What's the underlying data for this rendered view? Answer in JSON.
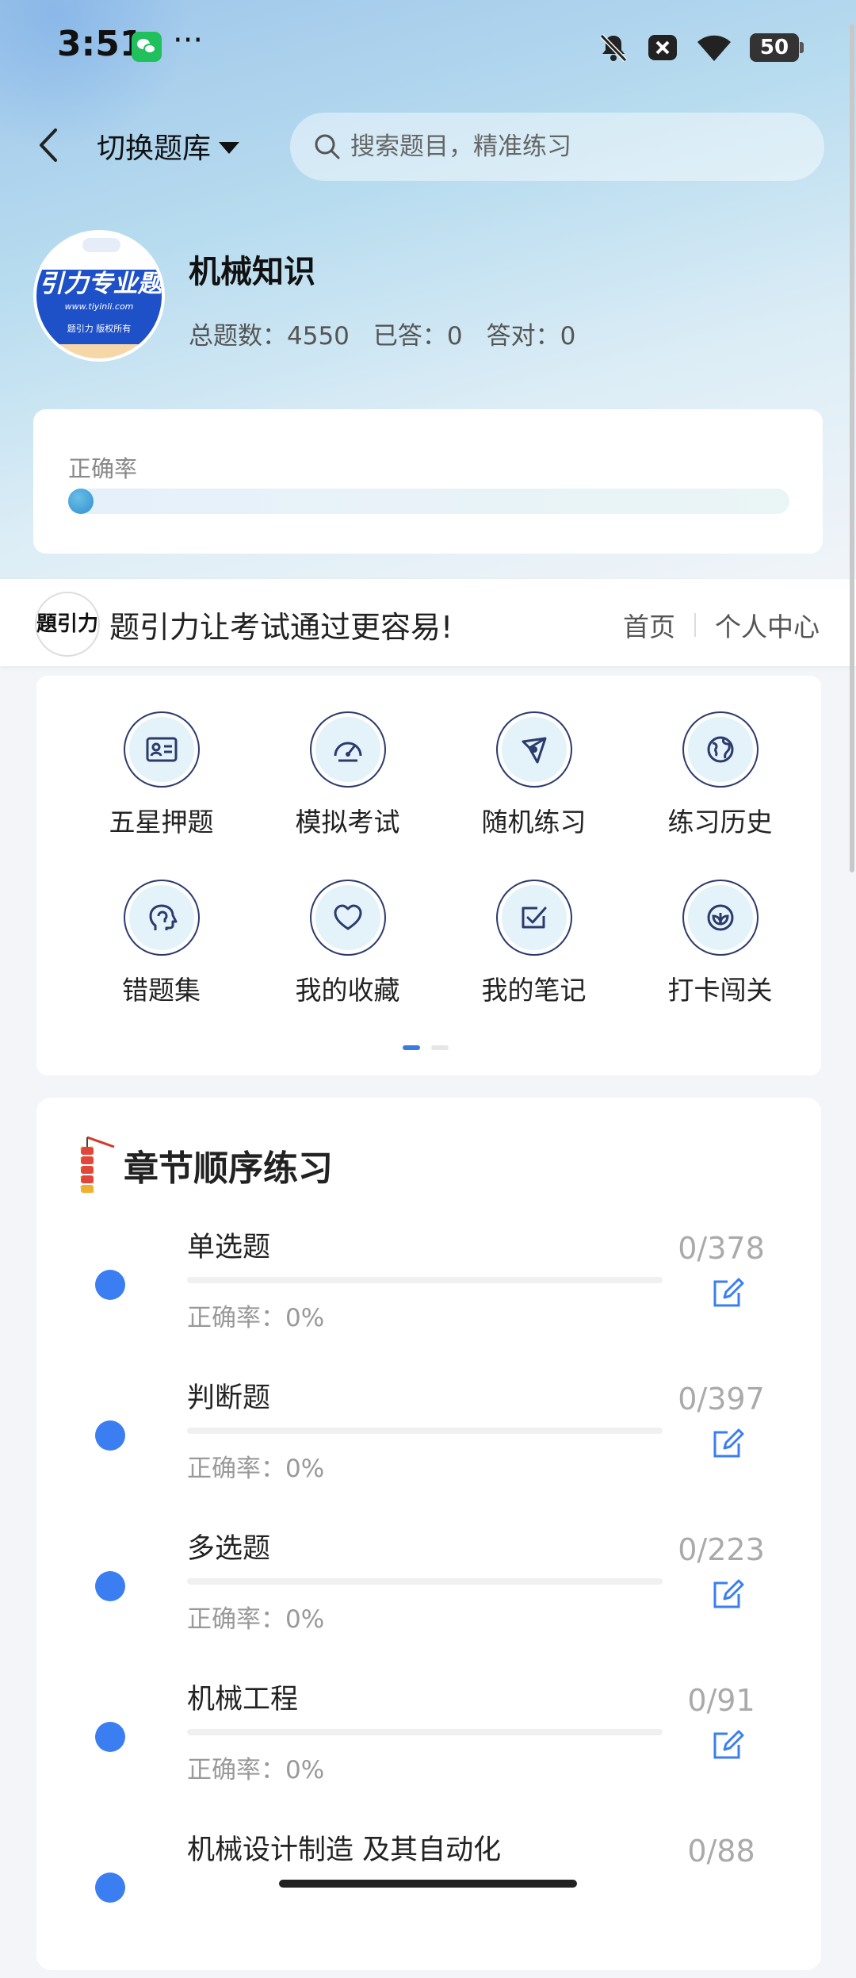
{
  "status_bar": {
    "time": "3:51",
    "more": "···",
    "battery": "50"
  },
  "topbar": {
    "switch_label": "切换题库",
    "search_placeholder": "搜索题目，精准练习"
  },
  "bank": {
    "name": "机械知识",
    "total_label": "总题数：4550",
    "answered_label": "已答：0",
    "correct_label": "答对：0",
    "logo_text": "引力专业题",
    "logo_url": "www.tiyinli.com",
    "logo_copyright": "题引力 版权所有"
  },
  "accuracy": {
    "label": "正确率",
    "value": 0
  },
  "promo": {
    "logo_text": "題引力",
    "slogan": "题引力让考试通过更容易!",
    "home_link": "首页",
    "profile_link": "个人中心"
  },
  "menu": {
    "items": [
      {
        "label": "五星押题",
        "icon": "id-card-icon"
      },
      {
        "label": "模拟考试",
        "icon": "speedometer-icon"
      },
      {
        "label": "随机练习",
        "icon": "network-icon"
      },
      {
        "label": "练习历史",
        "icon": "globe-icon"
      },
      {
        "label": "错题集",
        "icon": "head-icon"
      },
      {
        "label": "我的收藏",
        "icon": "heart-icon"
      },
      {
        "label": "我的笔记",
        "icon": "checkbox-icon"
      },
      {
        "label": "打卡闯关",
        "icon": "leaf-icon"
      }
    ],
    "page": 1,
    "pages": 2
  },
  "chapters": {
    "title": "章节顺序练习",
    "items": [
      {
        "name": "单选题",
        "rate": "正确率：0%",
        "count": "0/378",
        "progress": 0
      },
      {
        "name": "判断题",
        "rate": "正确率：0%",
        "count": "0/397",
        "progress": 0
      },
      {
        "name": "多选题",
        "rate": "正确率：0%",
        "count": "0/223",
        "progress": 0
      },
      {
        "name": "机械工程",
        "rate": "正确率：0%",
        "count": "0/91",
        "progress": 0
      },
      {
        "name": "机械设计制造 及其自动化",
        "rate": "",
        "count": "0/88",
        "progress": 0
      }
    ]
  },
  "colors": {
    "accent": "#3a7ef2",
    "icon_bg": "#e4f3fa",
    "icon_stroke": "#2c3a6c"
  }
}
